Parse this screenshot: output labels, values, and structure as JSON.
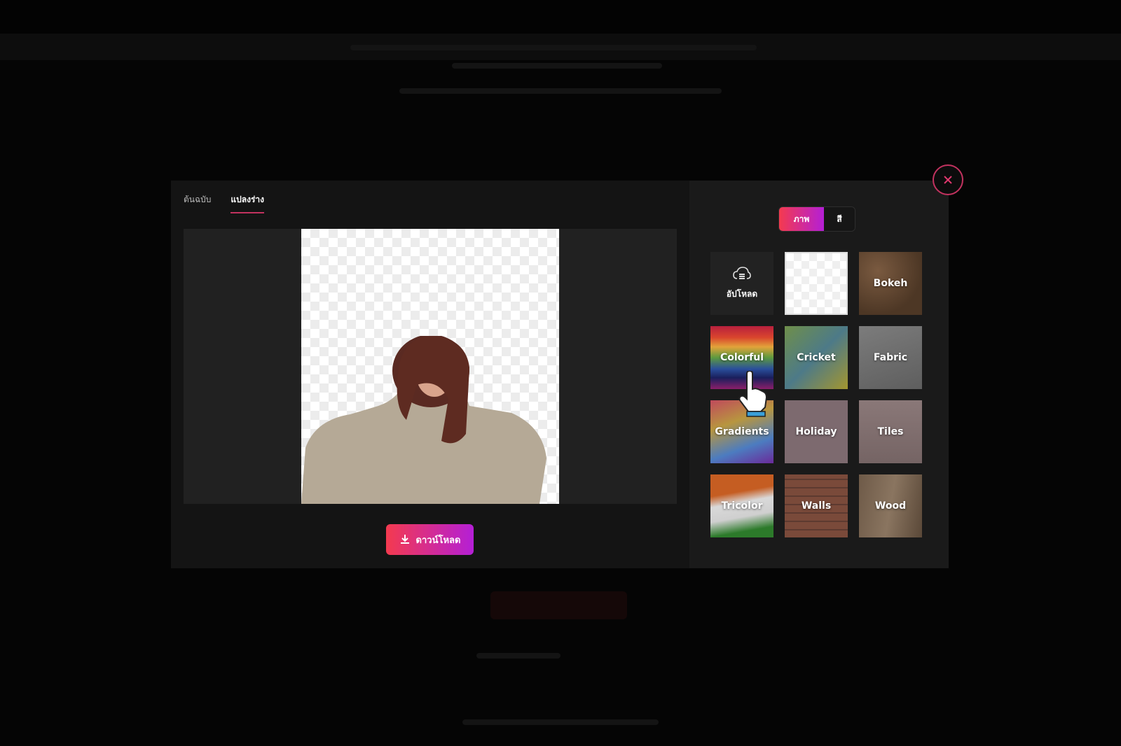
{
  "modal": {
    "tabs": [
      {
        "label": "ต้นฉบับ",
        "active": false
      },
      {
        "label": "แปลงร่าง",
        "active": true
      }
    ],
    "download_label": "ดาวน์โหลด",
    "background_mode": {
      "options": [
        {
          "label": "ภาพ",
          "active": true
        },
        {
          "label": "สี",
          "active": false
        }
      ]
    },
    "background_tiles": [
      {
        "label": "อัปโหลด",
        "type": "upload",
        "icon": "cloud-upload-icon"
      },
      {
        "label": "",
        "type": "transparent"
      },
      {
        "label": "Bokeh",
        "type": "bokeh"
      },
      {
        "label": "Colorful",
        "type": "colorful"
      },
      {
        "label": "Cricket",
        "type": "cricket"
      },
      {
        "label": "Fabric",
        "type": "fabric"
      },
      {
        "label": "Gradients",
        "type": "gradients"
      },
      {
        "label": "Holiday",
        "type": "holiday"
      },
      {
        "label": "Tiles",
        "type": "tiles"
      },
      {
        "label": "Tricolor",
        "type": "tricolor"
      },
      {
        "label": "Walls",
        "type": "walls"
      },
      {
        "label": "Wood",
        "type": "wood"
      }
    ],
    "close_icon": "close-icon",
    "accent_colors": {
      "gradient_start": "#f43a4f",
      "gradient_end": "#b41fd6",
      "close_ring": "#c2325f"
    }
  }
}
